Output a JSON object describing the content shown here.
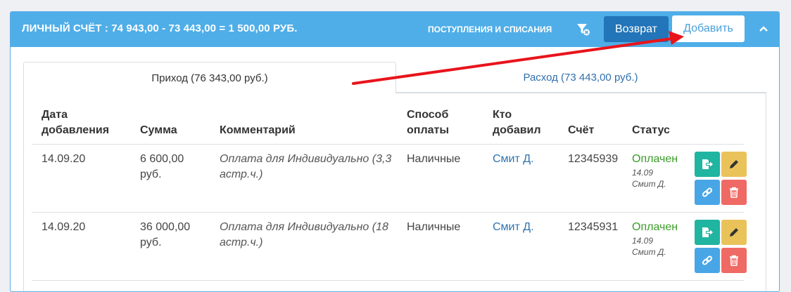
{
  "header": {
    "title": "ЛИЧНЫЙ СЧЁТ :  74 943,00 - 73 443,00 = 1 500,00 РУБ.",
    "flow_link": "ПОСТУПЛЕНИЯ И СПИСАНИЯ",
    "return_label": "Возврат",
    "add_label": "Добавить"
  },
  "tabs": {
    "income": "Приход (76 343,00 руб.)",
    "expense": "Расход (73 443,00 руб.)"
  },
  "table": {
    "headers": {
      "date_line1": "Дата",
      "date_line2": "добавления",
      "sum": "Сумма",
      "comment": "Комментарий",
      "method_line1": "Способ",
      "method_line2": "оплаты",
      "who_line1": "Кто",
      "who_line2": "добавил",
      "account": "Счёт",
      "status": "Статус"
    },
    "rows": [
      {
        "date": "14.09.20",
        "sum_line1": "6 600,00",
        "sum_line2": "руб.",
        "comment_line1": "Оплата для Индивидуально (3,3",
        "comment_line2": "астр.ч.)",
        "method": "Наличные",
        "who": "Смит Д.",
        "account": "12345939",
        "status": "Оплачен",
        "status_date": "14.09",
        "status_by": "Смит Д."
      },
      {
        "date": "14.09.20",
        "sum_line1": "36 000,00",
        "sum_line2": "руб.",
        "comment_line1": "Оплата для Индивидуально (18",
        "comment_line2": "астр.ч.)",
        "method": "Наличные",
        "who": "Смит Д.",
        "account": "12345931",
        "status": "Оплачен",
        "status_date": "14.09",
        "status_by": "Смит Д."
      }
    ]
  },
  "colors": {
    "header_bg": "#4faee8",
    "return_btn": "#2275b8",
    "status_paid": "#3c9c2a",
    "arrow": "#e8141b"
  },
  "icons": [
    "filter-icon",
    "chevron-up-icon",
    "export-icon",
    "pencil-icon",
    "link-icon",
    "trash-icon"
  ]
}
